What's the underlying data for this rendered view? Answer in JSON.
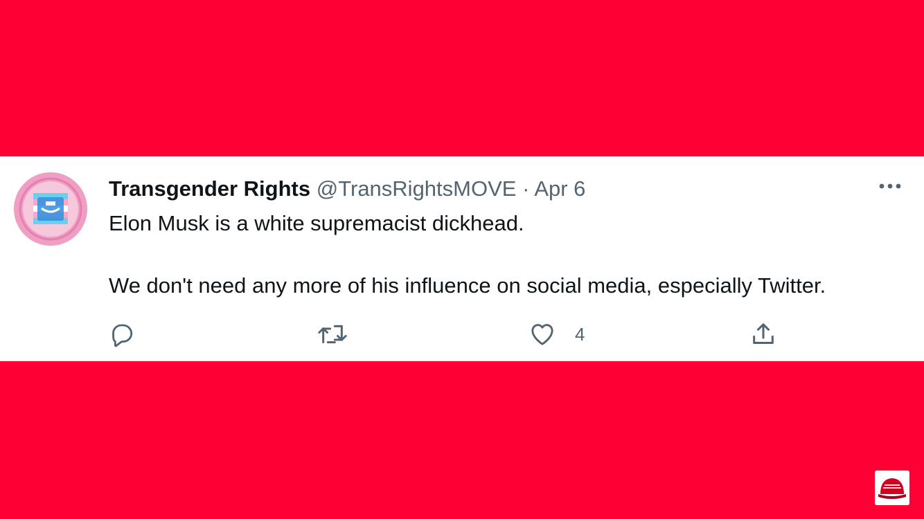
{
  "tweet": {
    "author": {
      "display_name": "Transgender Rights",
      "handle": "@TransRightsMOVE"
    },
    "separator": "·",
    "date": "Apr 6",
    "text": [
      "Elon Musk is a white supremacist dickhead.",
      "We don't need any more of his influence on social media, especially Twitter."
    ],
    "actions": {
      "reply_icon": "reply-icon",
      "retweet_icon": "retweet-icon",
      "like_icon": "heart-icon",
      "like_count": "4",
      "share_icon": "share-icon"
    },
    "more_icon": "more-horizontal-icon"
  },
  "colors": {
    "background": "#fe0034",
    "card": "#ffffff",
    "text_primary": "#0f1419",
    "text_secondary": "#536471",
    "avatar_ring": "#ef9fc4"
  },
  "channel_logo": {
    "icon": "red-cap-logo"
  }
}
